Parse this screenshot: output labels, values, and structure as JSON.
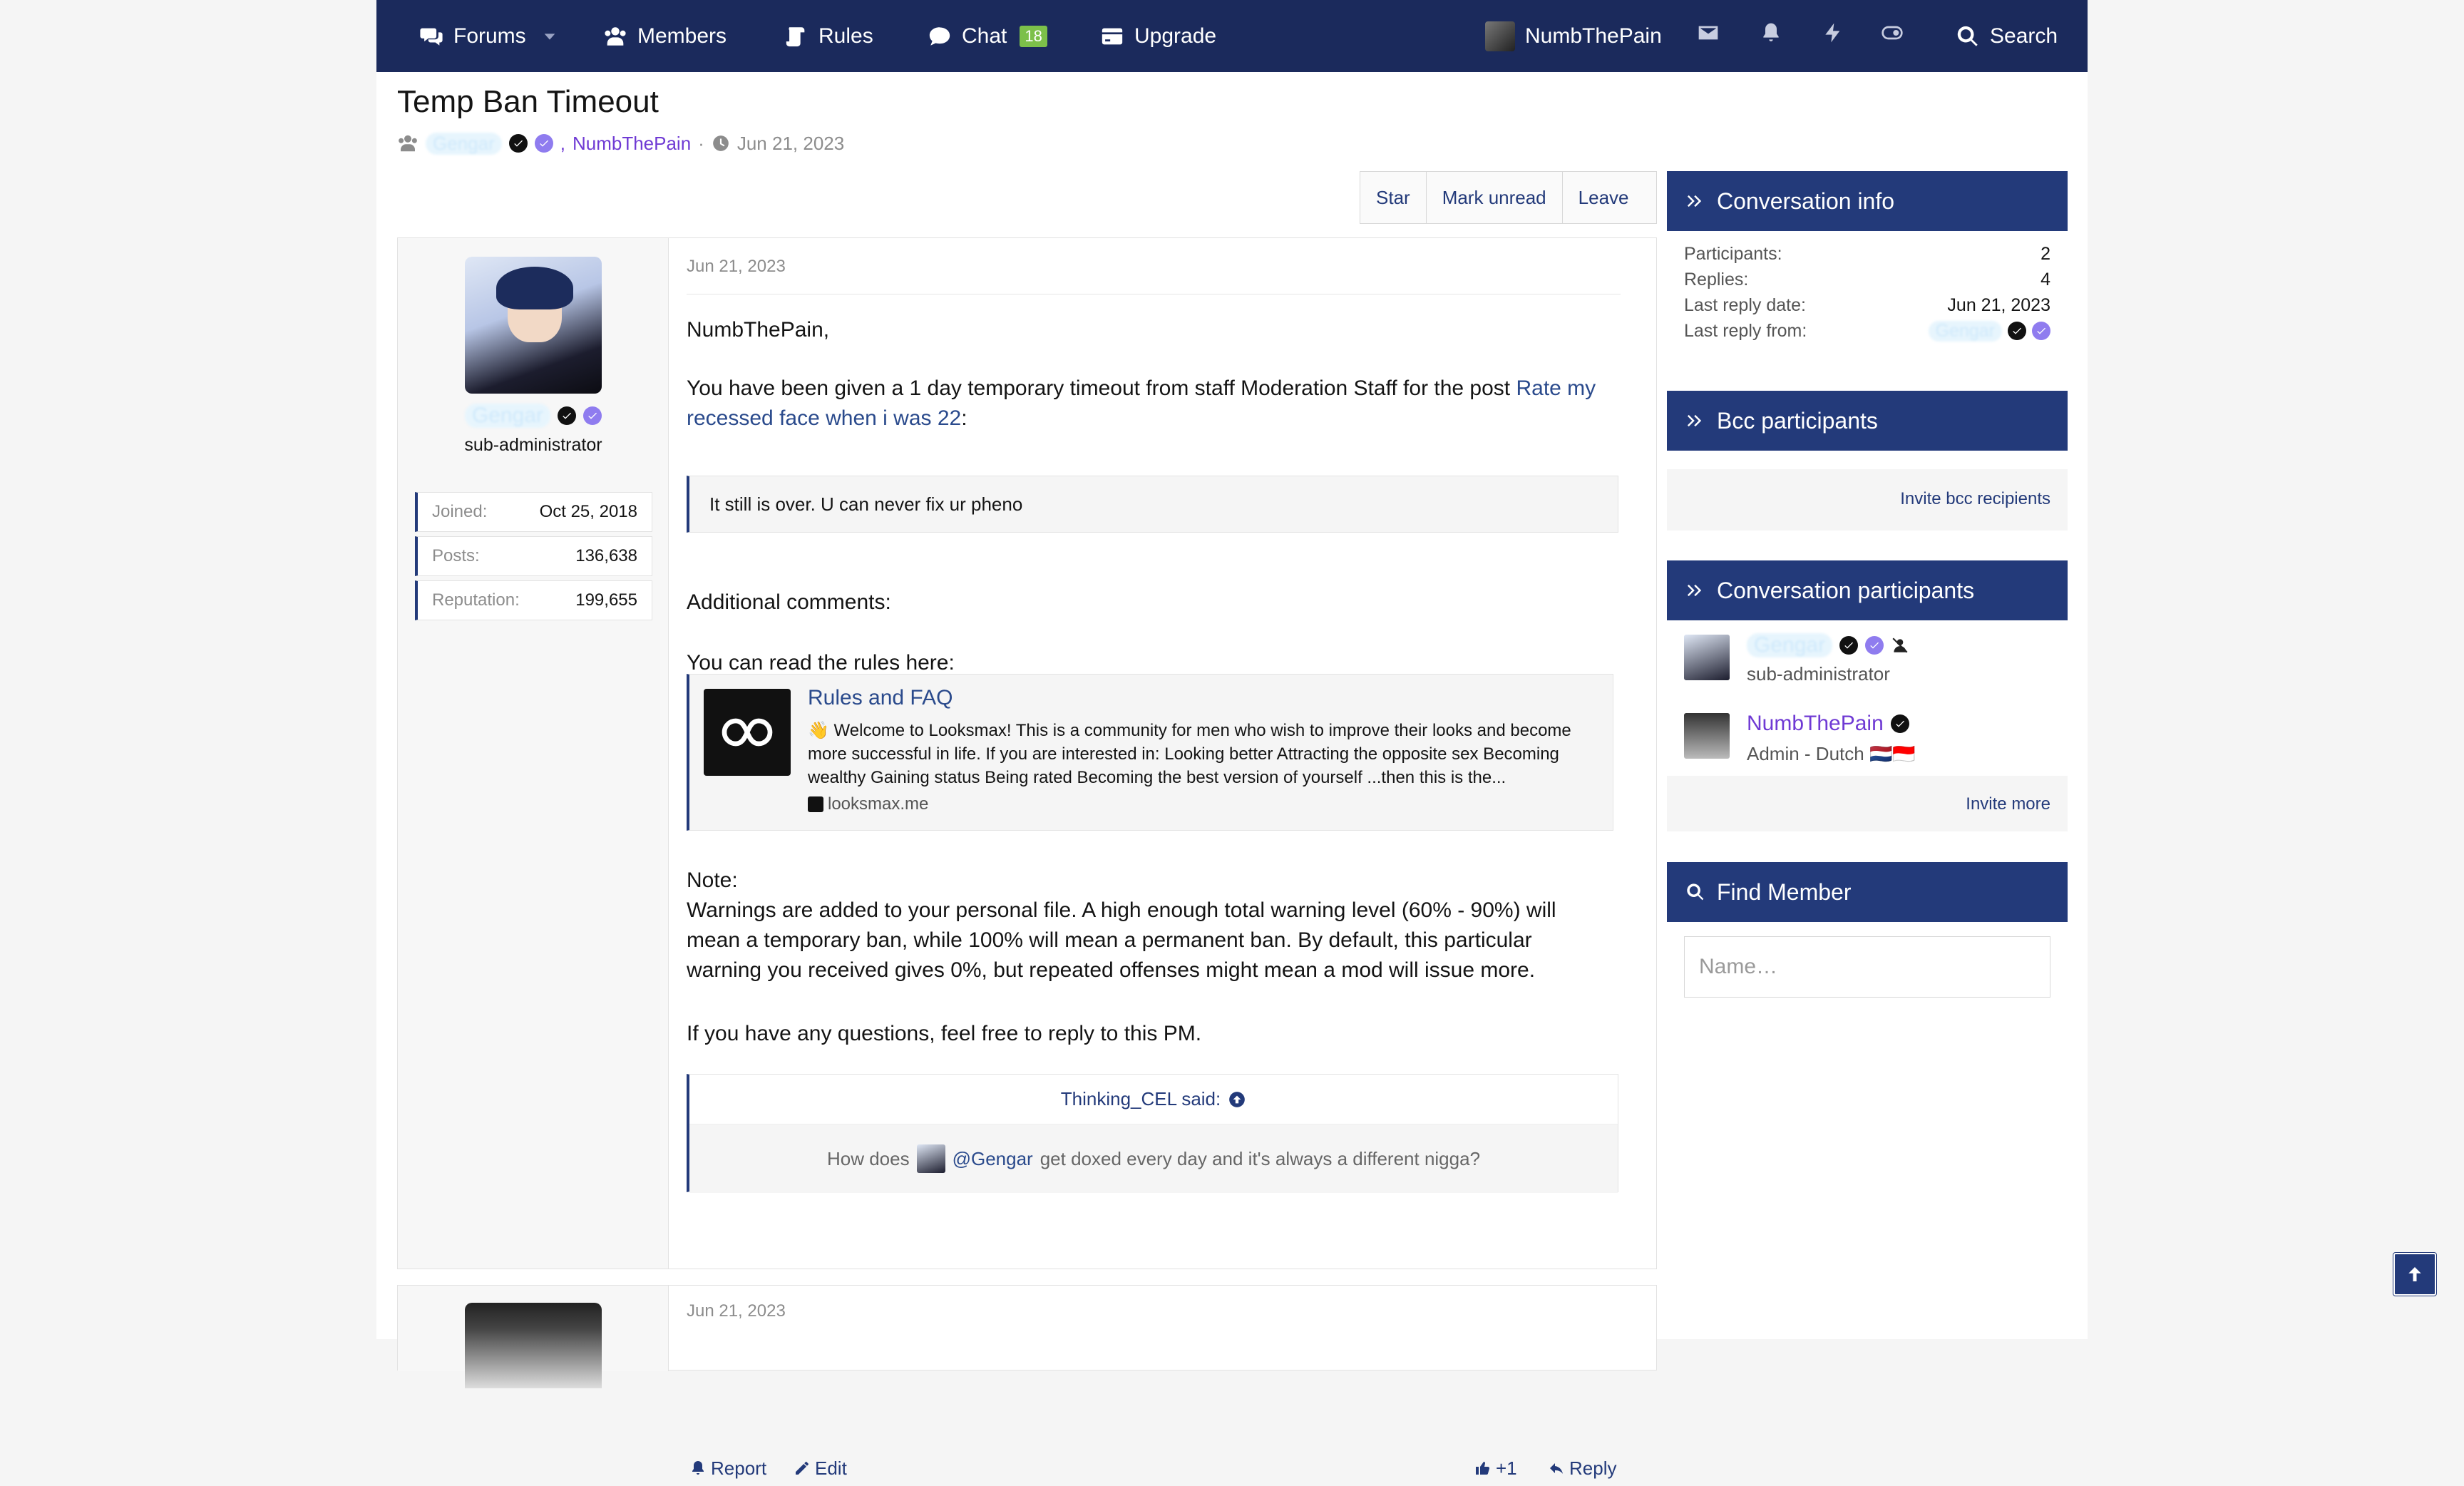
{
  "nav": {
    "forums": "Forums",
    "members": "Members",
    "rules": "Rules",
    "chat": "Chat",
    "chat_badge": "18",
    "upgrade": "Upgrade",
    "username": "NumbThePain",
    "search": "Search"
  },
  "thread": {
    "title": "Temp Ban Timeout",
    "participant_1": "Gengar",
    "separator": ",",
    "participant_2": "NumbThePain",
    "dot": "·",
    "date": "Jun 21, 2023"
  },
  "actions": {
    "star": "Star",
    "mark_unread": "Mark unread",
    "leave": "Leave"
  },
  "post": {
    "author": "Gengar",
    "author_title": "sub-administrator",
    "stats": [
      {
        "label": "Joined:",
        "value": "Oct 25, 2018"
      },
      {
        "label": "Posts:",
        "value": "136,638"
      },
      {
        "label": "Reputation:",
        "value": "199,655"
      }
    ],
    "date": "Jun 21, 2023",
    "greeting": "NumbThePain,",
    "line1_pre": "You have been given a 1 day temporary timeout from staff Moderation Staff for the post ",
    "line1_link_a": "Rate my",
    "line1_link_b": "recessed face when i was 22",
    "line1_post": ":",
    "quote": "It still is over. U can never fix ur pheno",
    "additional": "Additional comments:",
    "read_rules": "You can read the rules here:",
    "embed": {
      "title": "Rules and FAQ",
      "desc_1": "👋 Welcome to Looksmax! This is a community for men who wish to improve their looks and become",
      "desc_2": "more successful in life. If you are interested in: Looking better Attracting the opposite sex Becoming",
      "desc_3": "wealthy Gaining status Being rated Becoming the best version of yourself ...then this is the...",
      "site": "looksmax.me"
    },
    "note_label": "Note:",
    "note_1": "Warnings are added to your personal file. A high enough total warning level (60% - 90%) will",
    "note_2": "mean a temporary ban, while 100% will mean a permanent ban. By default, this particular",
    "note_3": "warning you received gives 0%, but repeated offenses might mean a mod will issue more.",
    "questions": "If you have any questions, feel free to reply to this PM.",
    "said_head": "Thinking_CEL said:",
    "said_pre": "How does",
    "said_mention": "@Gengar",
    "said_post": "get doxed every day and it's always a different nigga?",
    "report": "Report",
    "edit": "Edit",
    "reaction": "+1",
    "reply": "Reply"
  },
  "post2": {
    "date": "Jun 21, 2023"
  },
  "sidebar": {
    "conv_info": {
      "title": "Conversation info",
      "rows": [
        {
          "label": "Participants:",
          "value": "2"
        },
        {
          "label": "Replies:",
          "value": "4"
        },
        {
          "label": "Last reply date:",
          "value": "Jun 21, 2023"
        },
        {
          "label": "Last reply from:",
          "value": "Gengar"
        }
      ]
    },
    "bcc": {
      "title": "Bcc participants",
      "link": "Invite bcc recipients"
    },
    "participants": {
      "title": "Conversation participants",
      "p1_name": "Gengar",
      "p1_role": "sub-administrator",
      "p2_name": "NumbThePain",
      "p2_role": "Admin - Dutch 🇳🇱🇮🇩",
      "link": "Invite more"
    },
    "find": {
      "title": "Find Member",
      "placeholder": "Name…"
    }
  }
}
